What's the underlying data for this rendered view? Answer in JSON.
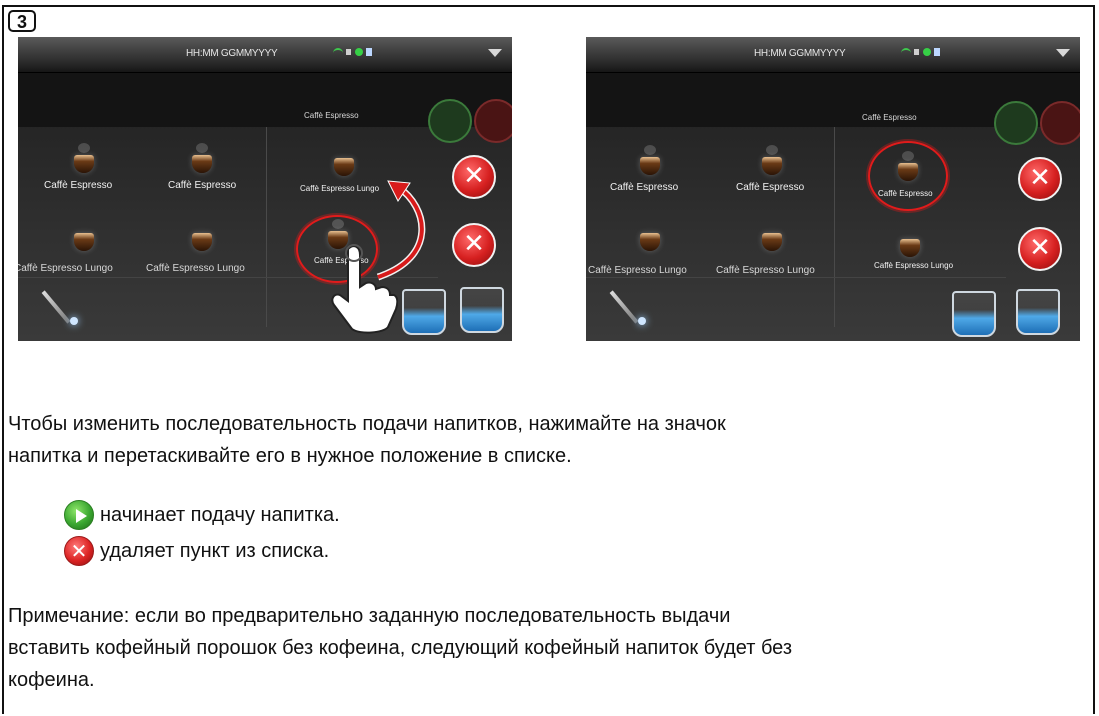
{
  "step": {
    "number": "3"
  },
  "screens": {
    "clock_text": "HH:MM GGMMYYYY",
    "left": {
      "top_label": "Caffè Espresso",
      "row1": [
        "Caffè Espresso",
        "Caffè Espresso",
        "Caffè Espresso Lungo"
      ],
      "row2": [
        "Caffè Espresso Lungo",
        "Caffè Espresso Lungo",
        "Caffè Espresso"
      ],
      "delete_symbol": "✕"
    },
    "right": {
      "top_label": "Caffè Espresso",
      "row1": [
        "Caffè Espresso",
        "Caffè Espresso",
        "Caffè Espresso"
      ],
      "row2": [
        "Caffè Espresso Lungo",
        "Caffè Espresso Lungo",
        "Caffè Espresso Lungo"
      ],
      "delete_symbol": "✕"
    }
  },
  "instructions": {
    "line1": "Чтобы изменить последовательность подачи напитков, нажимайте на значок",
    "line2": "напитка и перетаскивайте его в нужное положение в списке."
  },
  "legend": {
    "start_text": "начинает подачу напитка.",
    "delete_text": "удаляет пункт из списка.",
    "delete_symbol": "✕"
  },
  "note": {
    "line1": "Примечание: если во предварительно заданную последовательность выдачи",
    "line2": "вставить кофейный порошок без кофеина, следующий кофейный напиток будет без",
    "line3": "кофеина."
  },
  "colors": {
    "highlight_ring": "#e11b1b",
    "play_green": "#3aa630",
    "delete_red": "#d62020"
  }
}
